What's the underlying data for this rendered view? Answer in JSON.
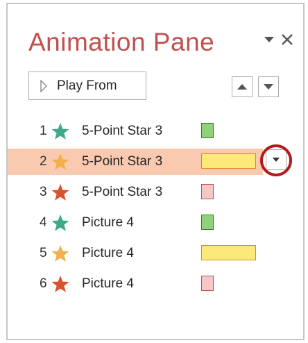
{
  "pane": {
    "title": "Animation Pane"
  },
  "toolbar": {
    "play_label": "Play From"
  },
  "colors": {
    "title": "#c0504d",
    "entrance_star": "#3fa98a",
    "emphasis_star": "#f2b04c",
    "exit_star": "#d9532c",
    "entrance_bar_fill": "#8fd27a",
    "entrance_bar_border": "#3c7a2c",
    "emphasis_bar_fill": "#fde97a",
    "emphasis_bar_border": "#d88a20",
    "exit_bar_fill": "#f8c6c6",
    "exit_bar_border": "#c0504d",
    "selected_row": "#f9c9b0",
    "callout": "#b31b1b"
  },
  "animations": [
    {
      "num": "1",
      "name": "5-Point Star 3",
      "effect": "entrance",
      "icon": "star-icon"
    },
    {
      "num": "2",
      "name": "5-Point Star 3",
      "effect": "emphasis",
      "icon": "star-icon",
      "selected": true
    },
    {
      "num": "3",
      "name": "5-Point Star 3",
      "effect": "exit",
      "icon": "star-icon"
    },
    {
      "num": "4",
      "name": "Picture 4",
      "effect": "entrance",
      "icon": "star-icon"
    },
    {
      "num": "5",
      "name": "Picture 4",
      "effect": "emphasis",
      "icon": "star-icon"
    },
    {
      "num": "6",
      "name": "Picture 4",
      "effect": "exit",
      "icon": "star-icon"
    }
  ]
}
